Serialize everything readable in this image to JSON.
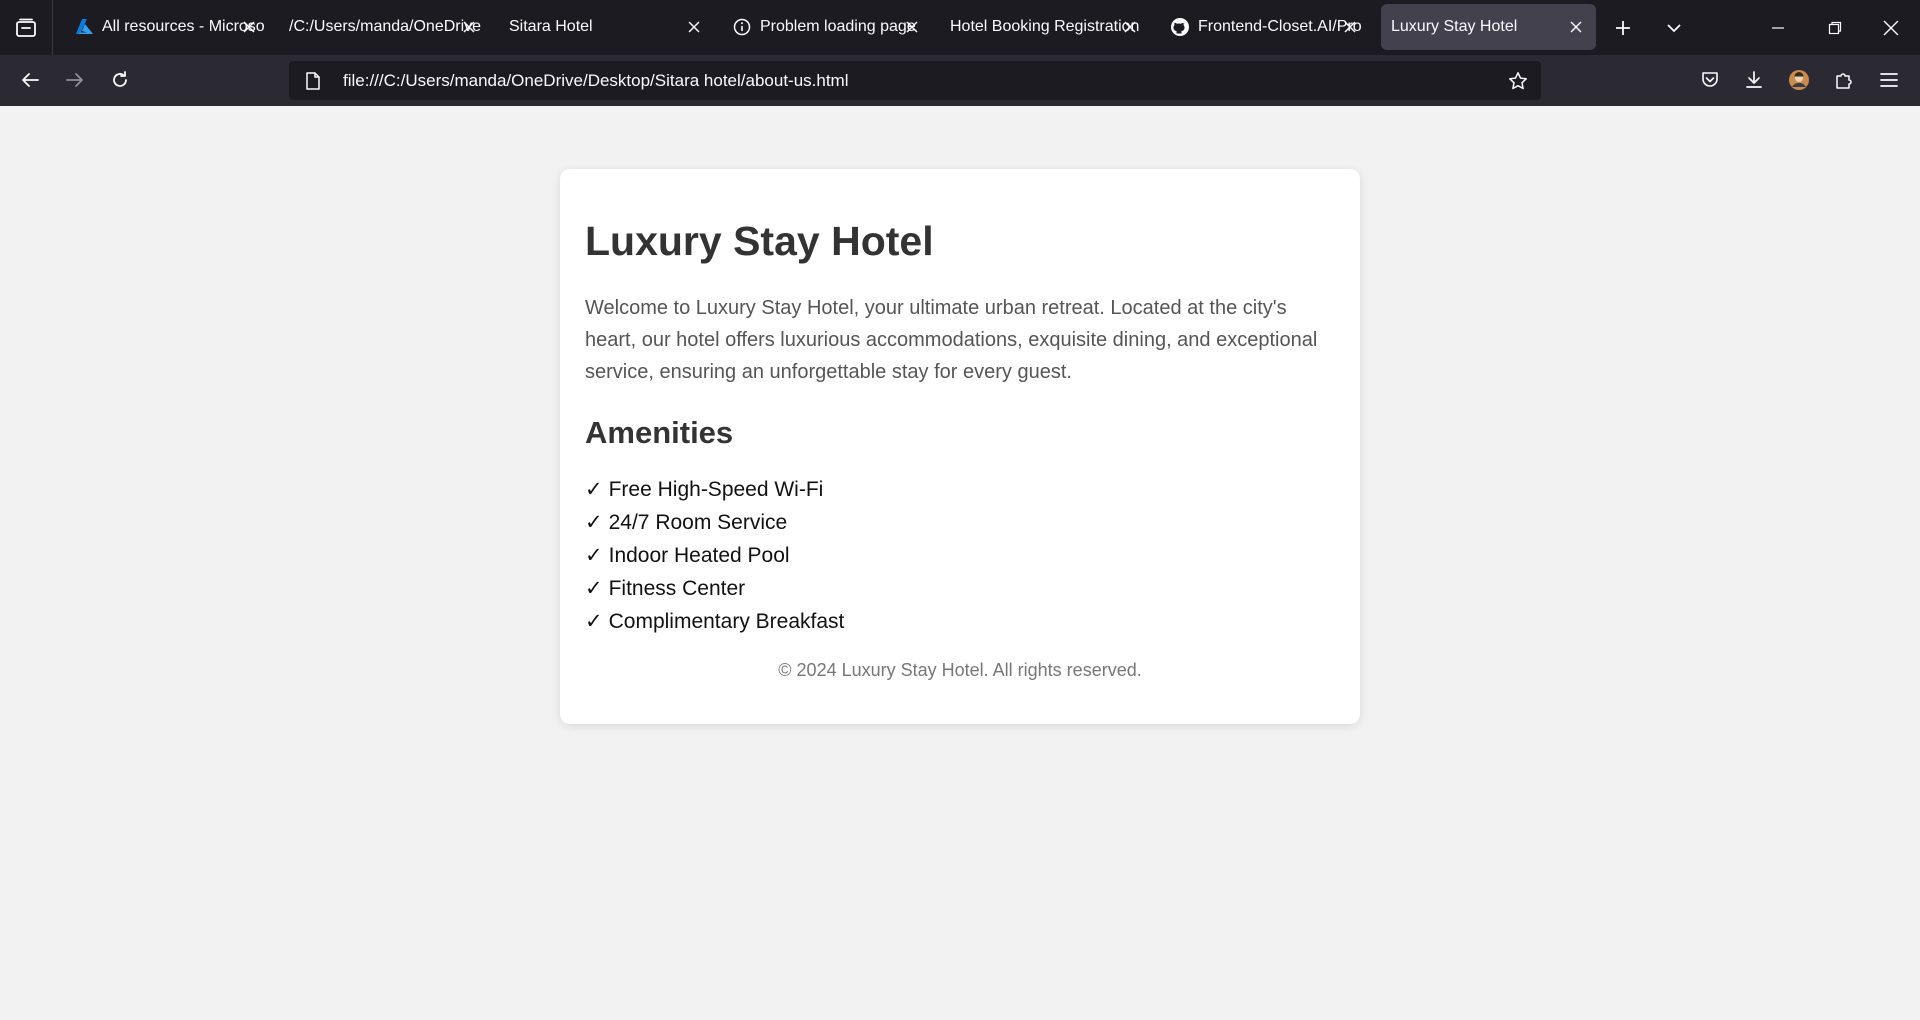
{
  "browser": {
    "tabs": [
      {
        "title": "All resources - Microsoft",
        "icon": "azure-icon"
      },
      {
        "title": "/C:/Users/manda/OneDrive",
        "icon": "none"
      },
      {
        "title": "Sitara Hotel",
        "icon": "none"
      },
      {
        "title": "Problem loading page",
        "icon": "info-icon"
      },
      {
        "title": "Hotel Booking Registration",
        "icon": "none"
      },
      {
        "title": "Frontend-Closet.AI/Pro",
        "icon": "github-icon"
      },
      {
        "title": "Luxury Stay Hotel",
        "icon": "none",
        "active": true
      }
    ],
    "url": "file:///C:/Users/manda/OneDrive/Desktop/Sitara hotel/about-us.html",
    "colors": {
      "chrome_dark": "#1c1b22",
      "toolbar": "#2b2a33",
      "active_tab": "#42414d"
    }
  },
  "page": {
    "title": "Luxury Stay Hotel",
    "intro": "Welcome to Luxury Stay Hotel, your ultimate urban retreat. Located at the city's heart, our hotel offers luxurious accommodations, exquisite dining, and exceptional service, ensuring an unforgettable stay for every guest.",
    "amenities_heading": "Amenities",
    "check_glyph": "✓",
    "amenities": [
      "Free High-Speed Wi-Fi",
      "24/7 Room Service",
      "Indoor Heated Pool",
      "Fitness Center",
      "Complimentary Breakfast"
    ],
    "footer": "© 2024 Luxury Stay Hotel. All rights reserved."
  }
}
